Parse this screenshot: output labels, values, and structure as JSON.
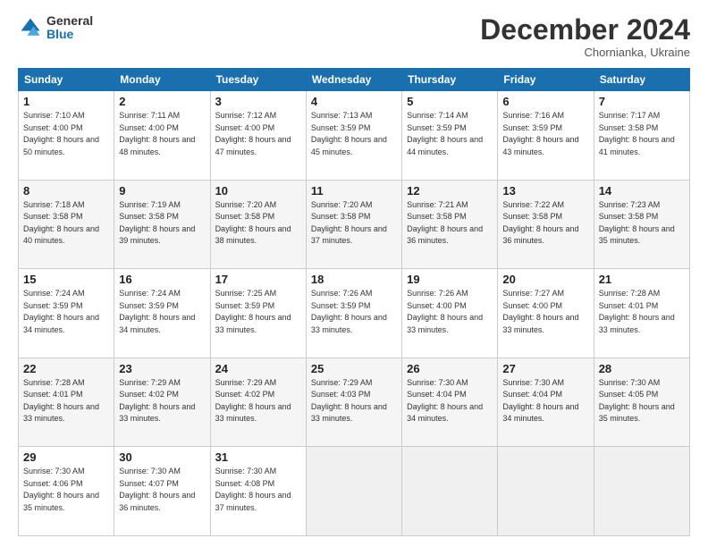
{
  "logo": {
    "general": "General",
    "blue": "Blue"
  },
  "header": {
    "month": "December 2024",
    "location": "Chornianka, Ukraine"
  },
  "weekdays": [
    "Sunday",
    "Monday",
    "Tuesday",
    "Wednesday",
    "Thursday",
    "Friday",
    "Saturday"
  ],
  "weeks": [
    [
      {
        "day": "1",
        "sunrise": "7:10 AM",
        "sunset": "4:00 PM",
        "daylight": "8 hours and 50 minutes."
      },
      {
        "day": "2",
        "sunrise": "7:11 AM",
        "sunset": "4:00 PM",
        "daylight": "8 hours and 48 minutes."
      },
      {
        "day": "3",
        "sunrise": "7:12 AM",
        "sunset": "4:00 PM",
        "daylight": "8 hours and 47 minutes."
      },
      {
        "day": "4",
        "sunrise": "7:13 AM",
        "sunset": "3:59 PM",
        "daylight": "8 hours and 45 minutes."
      },
      {
        "day": "5",
        "sunrise": "7:14 AM",
        "sunset": "3:59 PM",
        "daylight": "8 hours and 44 minutes."
      },
      {
        "day": "6",
        "sunrise": "7:16 AM",
        "sunset": "3:59 PM",
        "daylight": "8 hours and 43 minutes."
      },
      {
        "day": "7",
        "sunrise": "7:17 AM",
        "sunset": "3:58 PM",
        "daylight": "8 hours and 41 minutes."
      }
    ],
    [
      {
        "day": "8",
        "sunrise": "7:18 AM",
        "sunset": "3:58 PM",
        "daylight": "8 hours and 40 minutes."
      },
      {
        "day": "9",
        "sunrise": "7:19 AM",
        "sunset": "3:58 PM",
        "daylight": "8 hours and 39 minutes."
      },
      {
        "day": "10",
        "sunrise": "7:20 AM",
        "sunset": "3:58 PM",
        "daylight": "8 hours and 38 minutes."
      },
      {
        "day": "11",
        "sunrise": "7:20 AM",
        "sunset": "3:58 PM",
        "daylight": "8 hours and 37 minutes."
      },
      {
        "day": "12",
        "sunrise": "7:21 AM",
        "sunset": "3:58 PM",
        "daylight": "8 hours and 36 minutes."
      },
      {
        "day": "13",
        "sunrise": "7:22 AM",
        "sunset": "3:58 PM",
        "daylight": "8 hours and 36 minutes."
      },
      {
        "day": "14",
        "sunrise": "7:23 AM",
        "sunset": "3:58 PM",
        "daylight": "8 hours and 35 minutes."
      }
    ],
    [
      {
        "day": "15",
        "sunrise": "7:24 AM",
        "sunset": "3:59 PM",
        "daylight": "8 hours and 34 minutes."
      },
      {
        "day": "16",
        "sunrise": "7:24 AM",
        "sunset": "3:59 PM",
        "daylight": "8 hours and 34 minutes."
      },
      {
        "day": "17",
        "sunrise": "7:25 AM",
        "sunset": "3:59 PM",
        "daylight": "8 hours and 33 minutes."
      },
      {
        "day": "18",
        "sunrise": "7:26 AM",
        "sunset": "3:59 PM",
        "daylight": "8 hours and 33 minutes."
      },
      {
        "day": "19",
        "sunrise": "7:26 AM",
        "sunset": "4:00 PM",
        "daylight": "8 hours and 33 minutes."
      },
      {
        "day": "20",
        "sunrise": "7:27 AM",
        "sunset": "4:00 PM",
        "daylight": "8 hours and 33 minutes."
      },
      {
        "day": "21",
        "sunrise": "7:28 AM",
        "sunset": "4:01 PM",
        "daylight": "8 hours and 33 minutes."
      }
    ],
    [
      {
        "day": "22",
        "sunrise": "7:28 AM",
        "sunset": "4:01 PM",
        "daylight": "8 hours and 33 minutes."
      },
      {
        "day": "23",
        "sunrise": "7:29 AM",
        "sunset": "4:02 PM",
        "daylight": "8 hours and 33 minutes."
      },
      {
        "day": "24",
        "sunrise": "7:29 AM",
        "sunset": "4:02 PM",
        "daylight": "8 hours and 33 minutes."
      },
      {
        "day": "25",
        "sunrise": "7:29 AM",
        "sunset": "4:03 PM",
        "daylight": "8 hours and 33 minutes."
      },
      {
        "day": "26",
        "sunrise": "7:30 AM",
        "sunset": "4:04 PM",
        "daylight": "8 hours and 34 minutes."
      },
      {
        "day": "27",
        "sunrise": "7:30 AM",
        "sunset": "4:04 PM",
        "daylight": "8 hours and 34 minutes."
      },
      {
        "day": "28",
        "sunrise": "7:30 AM",
        "sunset": "4:05 PM",
        "daylight": "8 hours and 35 minutes."
      }
    ],
    [
      {
        "day": "29",
        "sunrise": "7:30 AM",
        "sunset": "4:06 PM",
        "daylight": "8 hours and 35 minutes."
      },
      {
        "day": "30",
        "sunrise": "7:30 AM",
        "sunset": "4:07 PM",
        "daylight": "8 hours and 36 minutes."
      },
      {
        "day": "31",
        "sunrise": "7:30 AM",
        "sunset": "4:08 PM",
        "daylight": "8 hours and 37 minutes."
      },
      null,
      null,
      null,
      null
    ]
  ]
}
